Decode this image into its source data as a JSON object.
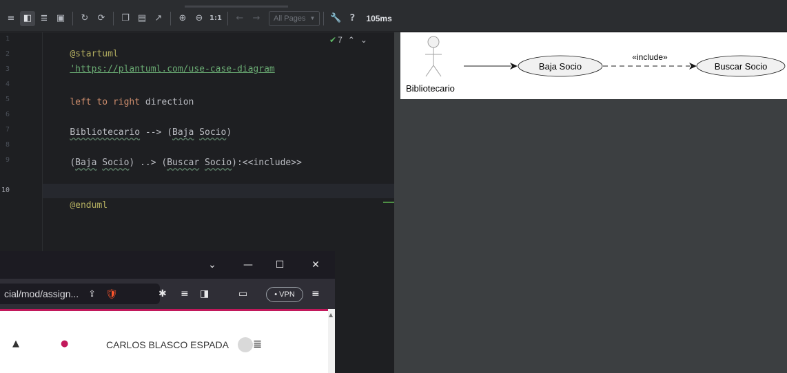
{
  "toolbar": {
    "pages_select": "All Pages",
    "pages_arrow": "▼",
    "zoom_reset": "1:1",
    "help": "?",
    "render_time": "105ms"
  },
  "editor": {
    "line_numbers": [
      "1",
      "2",
      "3",
      "4",
      "5",
      "6",
      "7",
      "8",
      "9",
      "10"
    ],
    "inspection_count": "7",
    "lines": {
      "l1": "@startuml",
      "l2": "'https://plantuml.com/use-case-diagram",
      "l4_a": "left to ",
      "l4_b": "right",
      "l4_c": " direction",
      "l6_a": "Bibliotecario",
      "l6_b": " --> (",
      "l6_c": "Baja",
      "l6_d": " ",
      "l6_e": "Socio",
      "l6_f": ")",
      "l8_a": "(",
      "l8_b": "Baja",
      "l8_c": " ",
      "l8_d": "Socio",
      "l8_e": ") ..> (",
      "l8_f": "Buscar",
      "l8_g": " ",
      "l8_h": "Socio",
      "l8_i": "):<<include>>",
      "l10": "@enduml"
    }
  },
  "diagram": {
    "actor": "Bibliotecario",
    "usecase1": "Baja Socio",
    "usecase2": "Buscar Socio",
    "relation": "«include»"
  },
  "browser": {
    "url": "cial/mod/assign...",
    "vpn": "• VPN",
    "user": "CARLOS BLASCO ESPADA"
  }
}
